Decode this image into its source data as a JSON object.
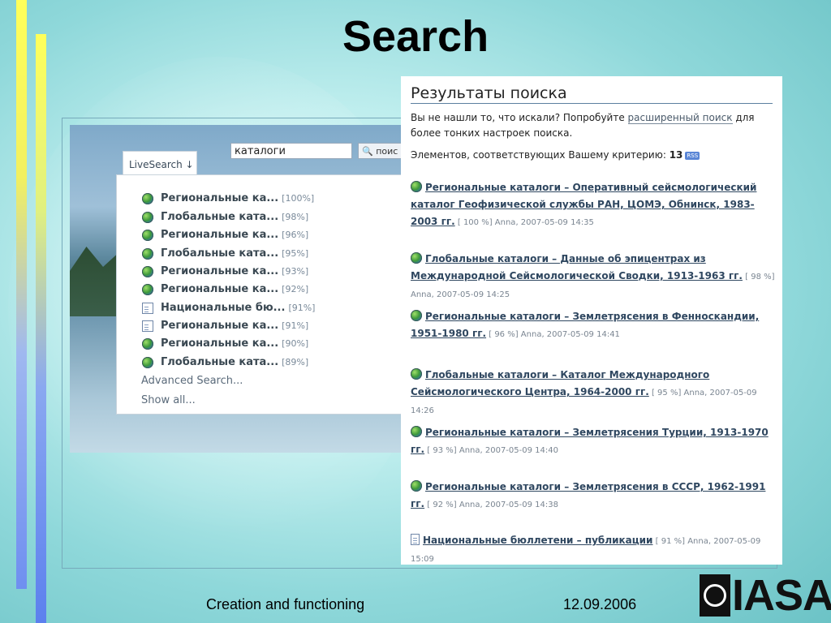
{
  "slide": {
    "title": "Search",
    "footer_left": "Creation and functioning",
    "footer_date": "12.09.2006",
    "logo_text": "IASA"
  },
  "widget": {
    "search_value": "каталоги",
    "search_button": "поис",
    "tab_label": "LiveSearch ↓",
    "items": [
      {
        "icon": "globe-icon",
        "label": "Региональные ка...",
        "pct": "[100%]"
      },
      {
        "icon": "globe-icon",
        "label": "Глобальные ката...",
        "pct": "[98%]"
      },
      {
        "icon": "globe-icon",
        "label": "Региональные ка...",
        "pct": "[96%]"
      },
      {
        "icon": "globe-icon",
        "label": "Глобальные ката...",
        "pct": "[95%]"
      },
      {
        "icon": "globe-icon",
        "label": "Региональные ка...",
        "pct": "[93%]"
      },
      {
        "icon": "globe-icon",
        "label": "Региональные ка...",
        "pct": "[92%]"
      },
      {
        "icon": "document-icon",
        "label": "Национальные бю...",
        "pct": "[91%]"
      },
      {
        "icon": "document-icon",
        "label": "Региональные ка...",
        "pct": "[91%]"
      },
      {
        "icon": "globe-icon",
        "label": "Региональные ка...",
        "pct": "[90%]"
      },
      {
        "icon": "globe-icon",
        "label": "Глобальные ката...",
        "pct": "[89%]"
      }
    ],
    "advanced_link": "Advanced Search...",
    "show_all_link": "Show all..."
  },
  "results": {
    "title": "Результаты поиска",
    "intro_before": "Вы не нашли то, что искали? Попробуйте ",
    "intro_link": "расширенный поиск",
    "intro_after": " для более тонких настроек поиска.",
    "count_label": "Элементов, соответствующих Вашему критерию: ",
    "count_value": "13",
    "rss_label": "RSS",
    "items": [
      {
        "icon": "globe-icon",
        "title": "Региональные каталоги – Оперативный сейсмологический каталог Геофизической службы РАН, ЦОМЭ, Обнинск, 1983-2003 гг.",
        "meta": " [ 100 %] Anna, 2007-05-09 14:35"
      },
      {
        "icon": "globe-icon",
        "title": "Глобальные каталоги – Данные об эпицентрах из Международной Сейсмологической Сводки, 1913-1963 гг.",
        "meta": " [ 98 %] Anna, 2007-05-09 14:25"
      },
      {
        "icon": "globe-icon",
        "title": "Региональные каталоги – Землетрясения в Фенноскандии, 1951-1980 гг.",
        "meta": " [ 96 %] Anna, 2007-05-09 14:41"
      },
      {
        "icon": "globe-icon",
        "title": "Глобальные каталоги – Каталог Международного Сейсмологического Центра, 1964-2000 гг.",
        "meta": " [ 95 %] Anna, 2007-05-09 14:26"
      },
      {
        "icon": "globe-icon",
        "title": "Региональные каталоги – Землетрясения Турции, 1913-1970 гг.",
        "meta": " [ 93 %] Anna, 2007-05-09 14:40"
      },
      {
        "icon": "globe-icon",
        "title": "Региональные каталоги – Землетрясения в СССР, 1962-1991 гг.",
        "meta": " [ 92 %] Anna, 2007-05-09 14:38"
      },
      {
        "icon": "document-icon",
        "title": "Национальные бюллетени – публикации",
        "meta": " [ 91 %] Anna, 2007-05-09 15:09"
      }
    ]
  }
}
